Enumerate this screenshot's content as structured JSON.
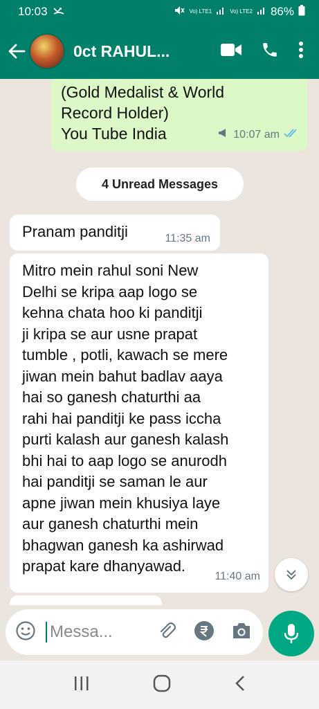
{
  "status": {
    "time": "10:03",
    "battery": "86%",
    "sim1": "Vo) LTE1",
    "sim2": "Vo) LTE2"
  },
  "header": {
    "contact_name": "0ct RAHUL..."
  },
  "messages": {
    "sent_line1": "(Gold Medalist & World",
    "sent_line2": "Record Holder)",
    "sent_line3": "You Tube India",
    "sent_time": "10:07 am",
    "unread_label": "4 Unread Messages",
    "msg1_text": "Pranam panditji",
    "msg1_time": "11:35 am",
    "msg2_lines": [
      "Mitro mein rahul soni New",
      "Delhi se kripa aap logo se",
      "kehna chata hoo ki panditji",
      "ji kripa se aur usne prapat",
      "tumble , potli, kawach se mere",
      "jiwan mein bahut badlav aaya",
      "hai so ganesh chaturthi aa",
      "rahi hai panditji ke pass iccha",
      "purti kalash aur ganesh kalash",
      "bhi hai to aap logo se anurodh",
      "hai panditji se  saman le aur",
      "apne jiwan mein khusiya laye",
      "aur ganesh chaturthi mein",
      "bhagwan ganesh ka ashirwad",
      "prapat kare dhanyawad."
    ],
    "msg2_time": "11:40 am"
  },
  "composer": {
    "placeholder": "Messa..."
  },
  "colors": {
    "header": "#008069",
    "sent_bubble": "#dcf8c6",
    "fab": "#00a884",
    "tick": "#53bdeb"
  }
}
